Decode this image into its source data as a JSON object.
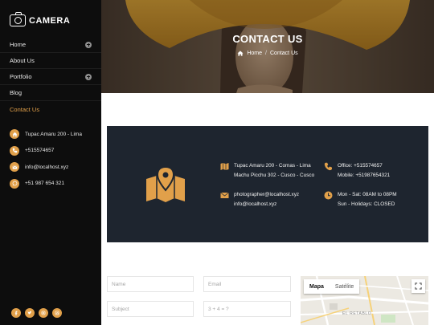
{
  "brand": {
    "name": "CAMERA"
  },
  "menu": [
    {
      "label": "Home",
      "has_submenu": true
    },
    {
      "label": "About Us",
      "has_submenu": false
    },
    {
      "label": "Portfolio",
      "has_submenu": true
    },
    {
      "label": "Blog",
      "has_submenu": false
    },
    {
      "label": "Contact Us",
      "has_submenu": false,
      "active": true
    }
  ],
  "sidebar_contacts": {
    "address": "Tupac Amaru 200 - Lima",
    "phone": "+515574657",
    "email": "info@localhost.xyz",
    "whatsapp": "+51 987 654 321"
  },
  "social_icons": [
    "facebook-icon",
    "twitter-icon",
    "instagram-icon",
    "linkedin-icon"
  ],
  "hero": {
    "title": "CONTACT US",
    "breadcrumb_home": "Home",
    "breadcrumb_separator": "/",
    "breadcrumb_current": "Contact Us"
  },
  "info": {
    "address_line1": "Tupac Amaru 200 - Comas - Lima",
    "address_line2": "Machu Picchu 302 - Cusco - Cusco",
    "phone_line1": "Office: +515574657",
    "phone_line2": "Mobile: +51987654321",
    "email_line1": "photographer@localhost.xyz",
    "email_line2": "info@localhost.xyz",
    "hours_line1": "Mon - Sat: 08AM to 08PM",
    "hours_line2": "Sun - Holidays: CLOSED"
  },
  "form": {
    "name_placeholder": "Name",
    "email_placeholder": "Email",
    "subject_placeholder": "Subject",
    "captcha_placeholder": "3 + 4 = ?"
  },
  "map": {
    "tab_map": "Mapa",
    "tab_satellite": "Satélite",
    "label": "EL RETABLO"
  },
  "colors": {
    "accent": "#e1a04a",
    "sidebar_bg": "#0d0d0d",
    "info_band_bg": "#1e252f"
  }
}
